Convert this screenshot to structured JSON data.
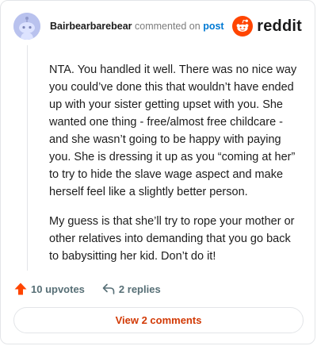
{
  "comment": {
    "username": "Bairbearbarebear",
    "action_text": "commented on",
    "post_link": "post",
    "paragraphs": [
      "NTA. You handled it well. There was no nice way you could’ve done this that wouldn’t have ended up with your sister getting upset with you. She wanted one thing - free/almost free childcare - and she wasn’t going to be happy with paying you. She is dressing it up as you “coming at her” to try to hide the slave wage aspect and make herself feel like a slightly better person.",
      "My guess is that she’ll try to rope your mother or other relatives into demanding that you go back to babysitting her kid. Don’t do it!"
    ]
  },
  "brand": {
    "name": "reddit",
    "icon": "reddit-alien-logo",
    "accent_color": "#ff4500"
  },
  "actions": {
    "upvotes_label": "10 upvotes",
    "replies_label": "2 replies",
    "upvote_icon": "upvote-arrow-icon",
    "reply_icon": "reply-arrow-icon",
    "upvote_color": "#ff4500"
  },
  "footer": {
    "view_comments_label": "View 2 comments",
    "button_text_color": "#d23a06"
  }
}
